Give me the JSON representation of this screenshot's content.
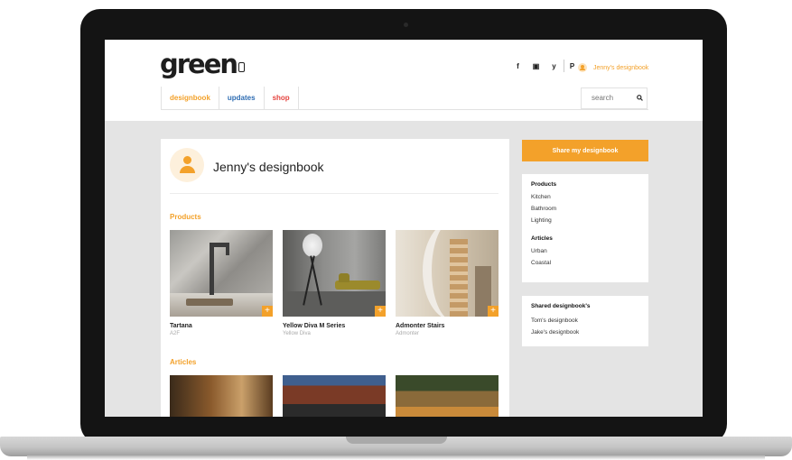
{
  "brand": {
    "logo_text": "green"
  },
  "header": {
    "social": [
      "f",
      "▣",
      "y",
      "P"
    ],
    "user_link": "Jenny's designbook",
    "tabs": [
      {
        "label": "designbook",
        "color": "#f3a12a"
      },
      {
        "label": "updates",
        "color": "#2f6db3"
      },
      {
        "label": "shop",
        "color": "#e54540"
      }
    ],
    "search_placeholder": "search"
  },
  "main": {
    "title": "Jenny's designbook",
    "products_heading": "Products",
    "products": [
      {
        "name": "Tartana",
        "brand": "A2F"
      },
      {
        "name": "Yellow Diva M Series",
        "brand": "Yellow Diva"
      },
      {
        "name": "Admonter Stairs",
        "brand": "Admonter"
      }
    ],
    "add_symbol": "+",
    "articles_heading": "Articles"
  },
  "sidebar": {
    "share_label": "Share my designbook",
    "filter_box": {
      "products_heading": "Products",
      "products": [
        "Kitchen",
        "Bathroom",
        "Lighting"
      ],
      "articles_heading": "Articles",
      "articles": [
        "Urban",
        "Coastal"
      ]
    },
    "shared_box": {
      "heading": "Shared designbook's",
      "items": [
        "Tom's designbook",
        "Jake's designbook"
      ]
    }
  },
  "colors": {
    "accent": "#f3a12a",
    "updates": "#2f6db3",
    "shop": "#e54540",
    "background": "#e4e4e4"
  }
}
